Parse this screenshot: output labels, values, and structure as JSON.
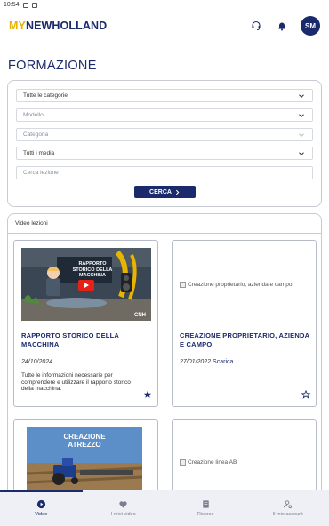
{
  "status_bar": {
    "time": "10:54"
  },
  "app_bar": {
    "logo_prefix": "MY",
    "logo_brand": "NEWHOLLAND",
    "avatar_initials": "SM",
    "icons": [
      "support-icon",
      "bell-icon"
    ]
  },
  "page": {
    "title": "FORMAZIONE"
  },
  "filters": {
    "category": "Tutte le categorie",
    "model_placeholder": "Modello",
    "sub_category_placeholder": "Categoria",
    "media": "Tutti i media",
    "search_placeholder": "Cerca lezione",
    "search_button": "CERCA"
  },
  "video_section": {
    "header": "Video lezioni",
    "lessons": [
      {
        "title": "RAPPORTO STORICO DELLA MACCHINA",
        "date": "24/10/2024",
        "description": "Tutte le informazioni necessarie per comprendere e utilizzare il rapporto storico della macchina.",
        "thumbnail_text": "RAPPORTO STORICO DELLA MACCHINA",
        "thumbnail_brand": "CNH",
        "favorite": true
      },
      {
        "title": "CREAZIONE PROPRIETARIO, AZIENDA E CAMPO",
        "date": "27/01/2022",
        "download_label": "Scarica",
        "image_alt": "Creazione proprietario, azienda e campo",
        "favorite": false
      },
      {
        "thumbnail_text": "CREAZIONE ATREZZO"
      },
      {
        "image_alt": "Creazione linea AB"
      }
    ]
  },
  "bottom_nav": {
    "items": [
      {
        "label": "Video",
        "icon": "play-circle-icon",
        "active": true
      },
      {
        "label": "I miei video",
        "icon": "heart-icon",
        "active": false
      },
      {
        "label": "Risorse",
        "icon": "document-icon",
        "active": false
      },
      {
        "label": "Il mio account",
        "icon": "account-settings-icon",
        "active": false
      }
    ]
  },
  "colors": {
    "primary": "#1b2a6b",
    "accent": "#e8b400",
    "nav_bg": "#eef0f5"
  }
}
